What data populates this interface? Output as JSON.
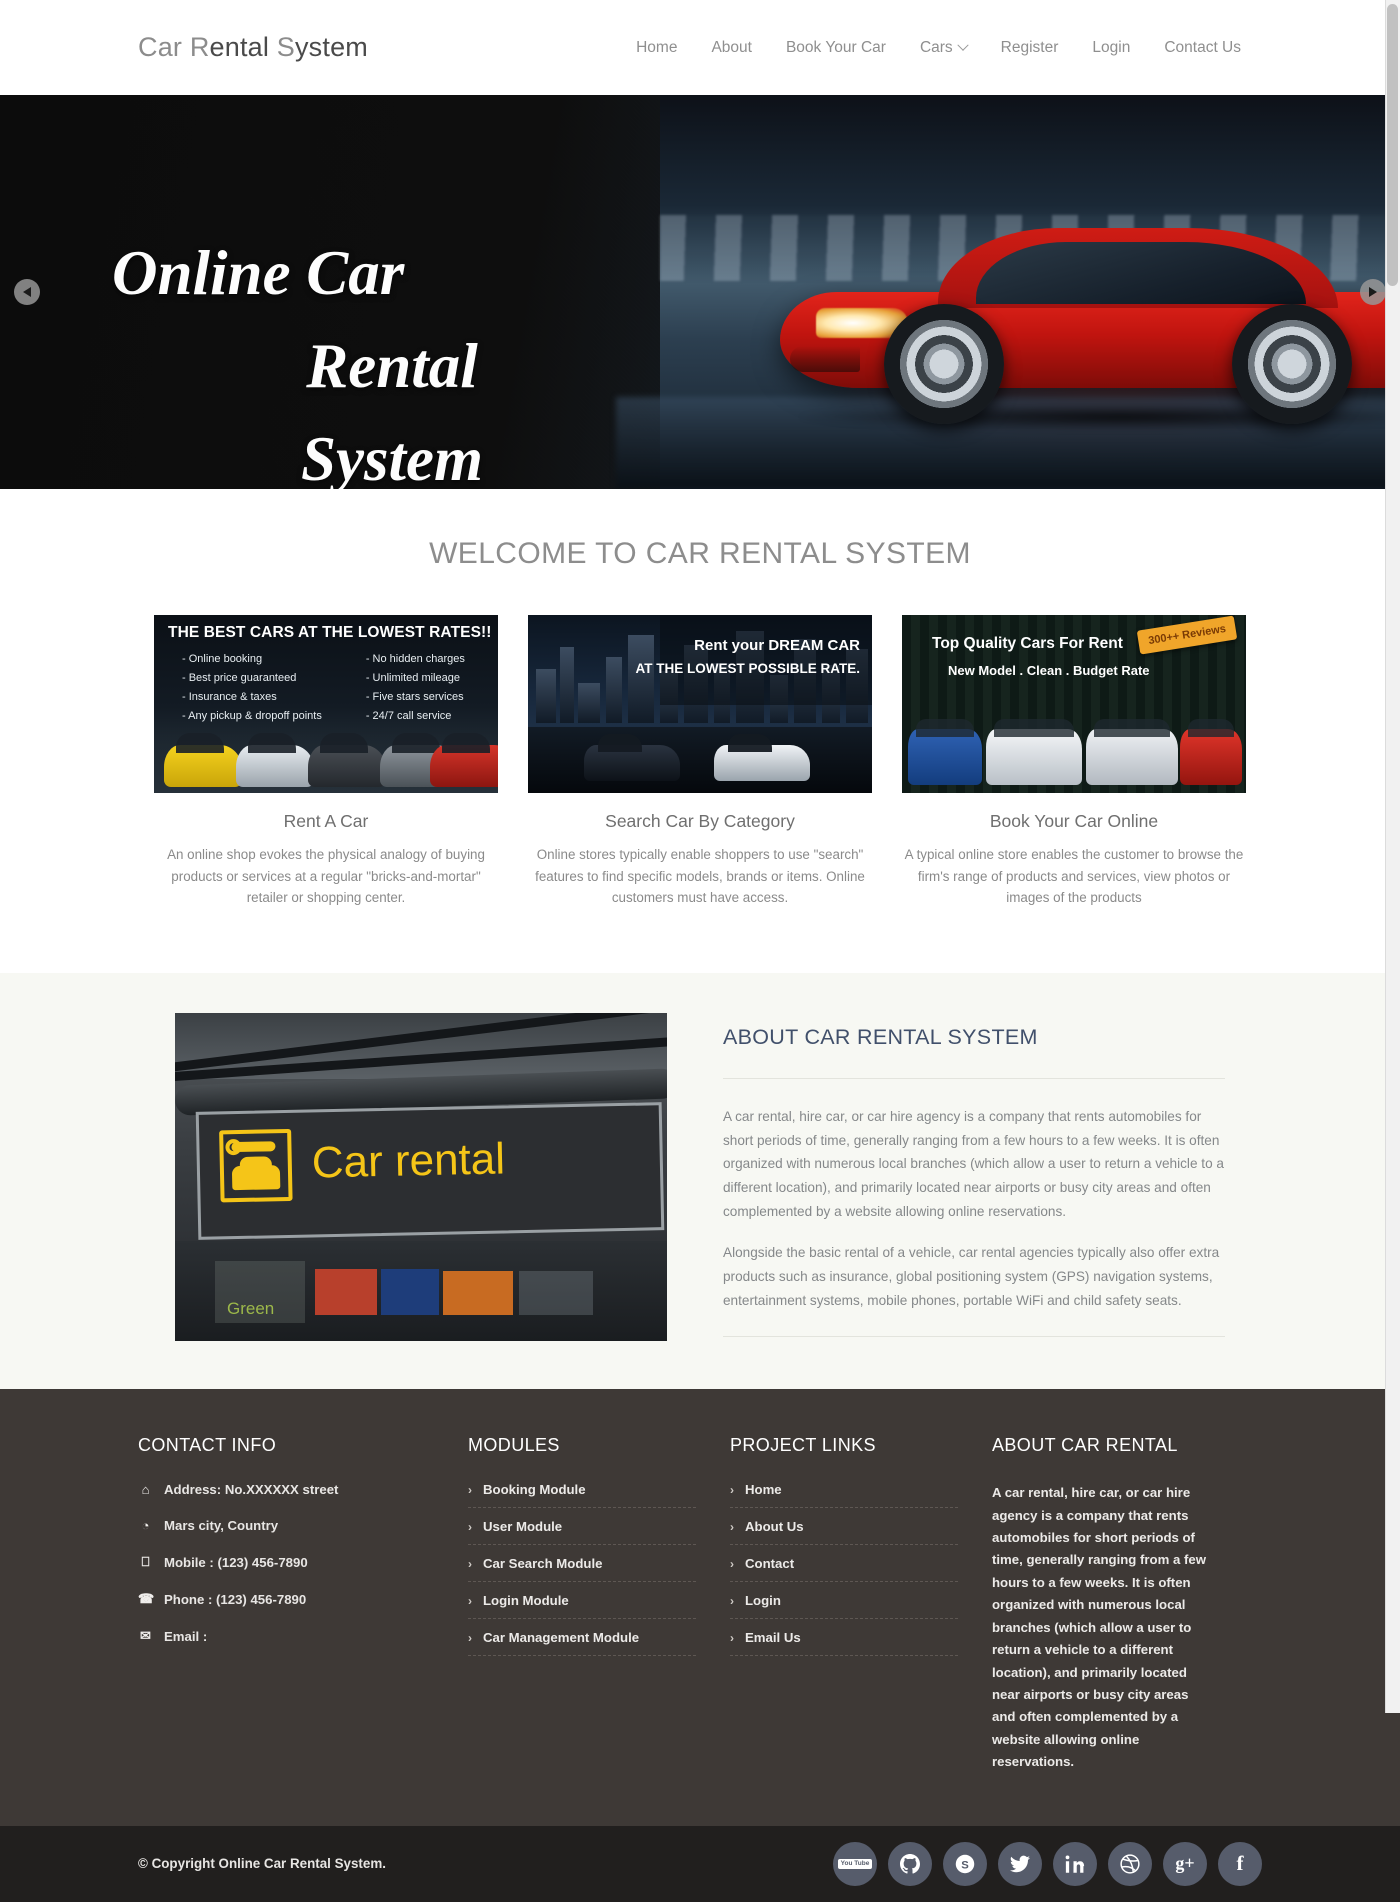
{
  "header": {
    "logo": {
      "part1": "Car ",
      "part2": "R",
      "part3": "ental ",
      "part4": "S",
      "part5": "ystem"
    },
    "nav": [
      {
        "label": "Home",
        "has_dropdown": false
      },
      {
        "label": "About",
        "has_dropdown": false
      },
      {
        "label": "Book Your Car",
        "has_dropdown": false
      },
      {
        "label": "Cars",
        "has_dropdown": true
      },
      {
        "label": "Register",
        "has_dropdown": false
      },
      {
        "label": "Login",
        "has_dropdown": false
      },
      {
        "label": "Contact Us",
        "has_dropdown": false
      }
    ]
  },
  "hero": {
    "line1": "Online Car",
    "line2": "Rental",
    "line3": "System",
    "prev_label": "Previous slide",
    "next_label": "Next slide"
  },
  "welcome": {
    "title": "WELCOME TO CAR RENTAL SYSTEM",
    "cards": [
      {
        "heading": "Rent A Car",
        "text": "An online shop evokes the physical analogy of buying products or services at a regular \"bricks-and-mortar\" retailer or shopping center.",
        "banner_title": "THE BEST CARS AT THE LOWEST RATES!!",
        "banner_col1": "- Online booking\n- Best price guaranteed\n- Insurance & taxes\n- Any pickup & dropoff points",
        "banner_col2": "- No hidden charges\n- Unlimited mileage\n- Five stars services\n- 24/7 call service"
      },
      {
        "heading": "Search Car By Category",
        "text": "Online stores typically enable shoppers to use \"search\" features to find specific models, brands or items. Online customers must have access.",
        "banner_title": "Rent your DREAM CAR",
        "banner_sub": "AT THE LOWEST POSSIBLE RATE."
      },
      {
        "heading": "Book Your Car Online",
        "text": "A typical online store enables the customer to browse the firm's range of products and services, view photos or images of the products",
        "banner_title": "Top Quality Cars For Rent",
        "banner_sub": "New Model . Clean . Budget Rate",
        "banner_badge": "300++ Reviews"
      }
    ]
  },
  "about": {
    "image_sign_text": "Car rental",
    "image_poster_text": "Green",
    "title": "ABOUT CAR RENTAL SYSTEM",
    "paragraph1": "A car rental, hire car, or car hire agency is a company that rents automobiles for short periods of time, generally ranging from a few hours to a few weeks. It is often organized with numerous local branches (which allow a user to return a vehicle to a different location), and primarily located near airports or busy city areas and often complemented by a website allowing online reservations.",
    "paragraph2": "Alongside the basic rental of a vehicle, car rental agencies typically also offer extra products such as insurance, global positioning system (GPS) navigation systems, entertainment systems, mobile phones, portable WiFi and child safety seats."
  },
  "footer": {
    "contact": {
      "title": "CONTACT INFO",
      "items": [
        {
          "icon": "home-icon",
          "glyph": "⌂",
          "text": "Address: No.XXXXXX street"
        },
        {
          "icon": "globe-icon",
          "glyph": "◔",
          "text": "Mars city, Country"
        },
        {
          "icon": "mobile-icon",
          "glyph": "⎕",
          "text": "Mobile : (123) 456-7890"
        },
        {
          "icon": "phone-icon",
          "glyph": "☎",
          "text": "Phone : (123) 456-7890"
        },
        {
          "icon": "envelope-icon",
          "glyph": "✉",
          "text": "Email :"
        }
      ]
    },
    "modules": {
      "title": "MODULES",
      "items": [
        "Booking Module",
        "User Module",
        "Car Search Module",
        "Login Module",
        "Car Management Module"
      ]
    },
    "project_links": {
      "title": "PROJECT LINKS",
      "items": [
        "Home",
        "About Us",
        "Contact",
        "Login",
        "Email Us"
      ]
    },
    "about": {
      "title": "ABOUT CAR RENTAL",
      "text": "A car rental, hire car, or car hire agency is a company that rents automobiles for short periods of time, generally ranging from a few hours to a few weeks. It is often organized with numerous local branches (which allow a user to return a vehicle to a different location), and primarily located near airports or busy city areas and often complemented by a website allowing online reservations."
    },
    "copyright": "© Copyright Online Car Rental System.",
    "socials": [
      {
        "name": "youtube",
        "label": "You Tube"
      },
      {
        "name": "github",
        "label": "GitHub"
      },
      {
        "name": "skype",
        "label": "Skype"
      },
      {
        "name": "twitter",
        "label": "Twitter"
      },
      {
        "name": "linkedin",
        "label": "LinkedIn"
      },
      {
        "name": "dribbble",
        "label": "Dribbble"
      },
      {
        "name": "google-plus",
        "label": "g+"
      },
      {
        "name": "facebook",
        "label": "f"
      }
    ]
  },
  "colors": {
    "footer_bg": "#3e3936",
    "copybar_bg": "#211f1e",
    "about_bg": "#f7f8f3",
    "about_heading": "#41506b",
    "social_circle": "#565c6b",
    "sign_yellow": "#f5c518"
  }
}
